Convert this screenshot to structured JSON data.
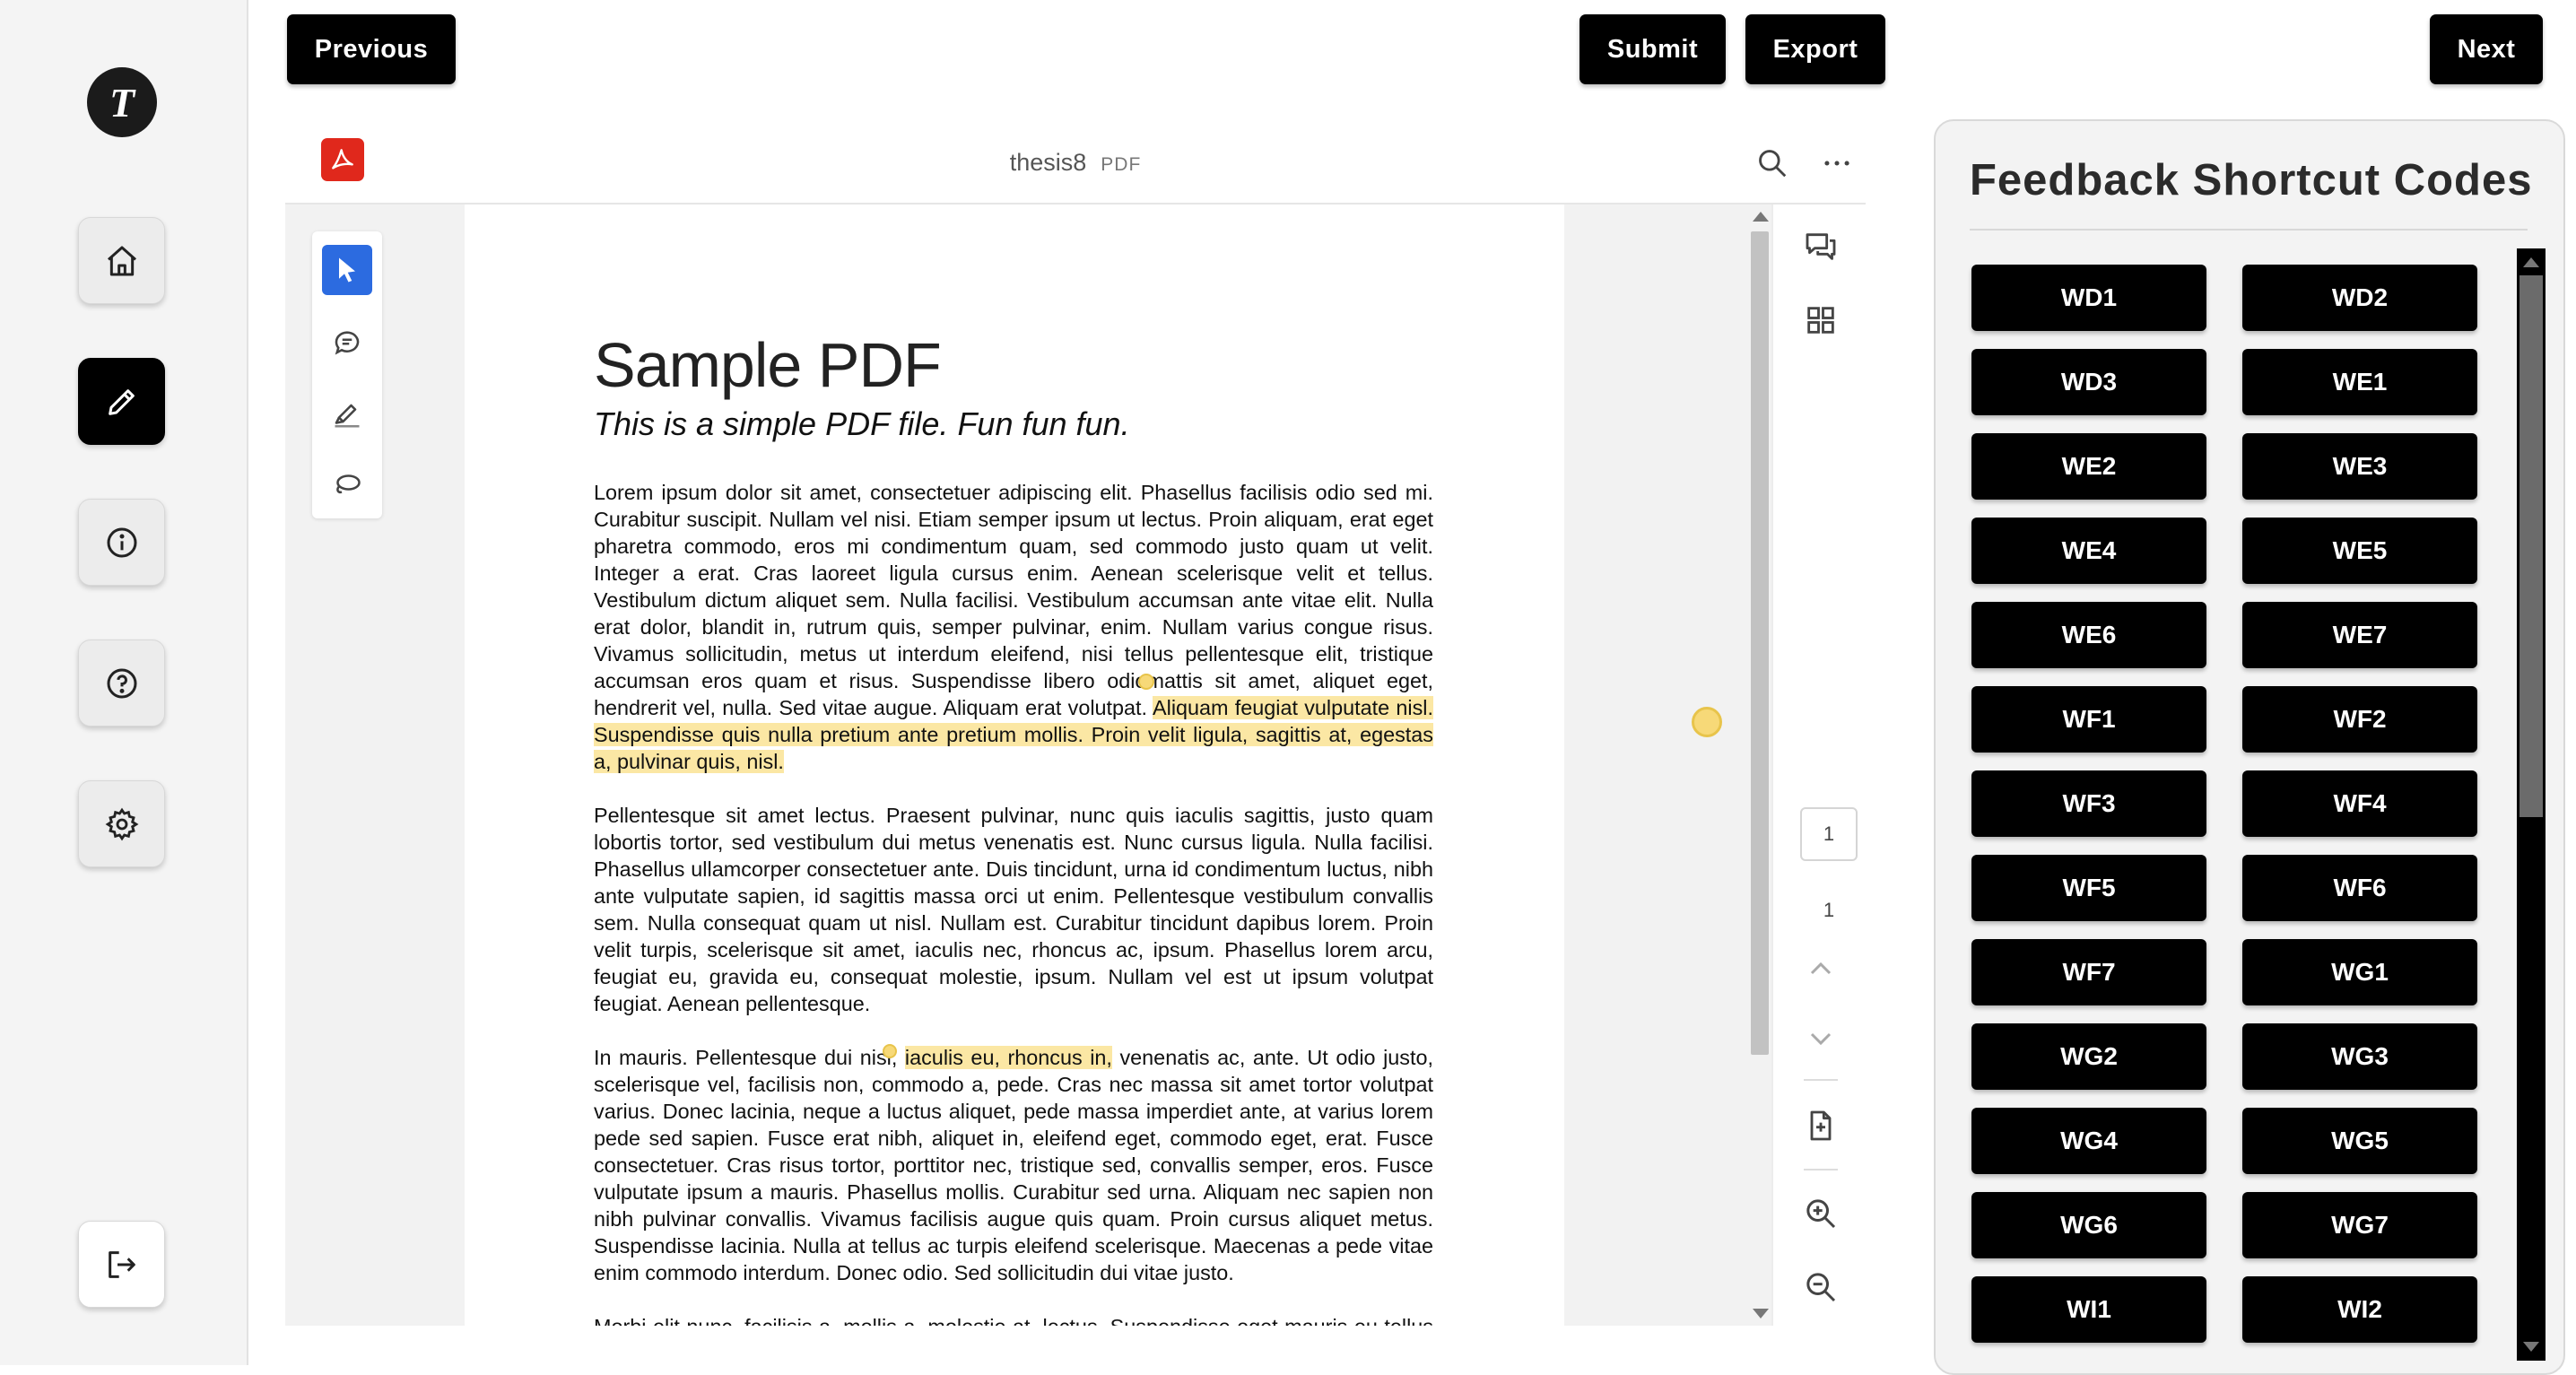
{
  "sidebar": {
    "logo_letter": "T",
    "items": [
      {
        "name": "home",
        "icon": "home-icon"
      },
      {
        "name": "edit",
        "icon": "pencil-icon",
        "active": true
      },
      {
        "name": "info",
        "icon": "info-icon"
      },
      {
        "name": "help",
        "icon": "help-icon"
      },
      {
        "name": "settings",
        "icon": "gear-icon"
      },
      {
        "name": "logout",
        "icon": "logout-icon"
      }
    ]
  },
  "toolbar": {
    "previous_label": "Previous",
    "submit_label": "Submit",
    "export_label": "Export",
    "next_label": "Next"
  },
  "viewer": {
    "file_name": "thesis8",
    "file_type": "PDF",
    "current_page": "1",
    "total_pages": "1",
    "tools": [
      "select-tool",
      "comment-tool",
      "highlight-tool",
      "lasso-tool"
    ]
  },
  "document": {
    "title": "Sample PDF",
    "subtitle": "This is a simple PDF file. Fun fun fun.",
    "para1": {
      "a": "Lorem ipsum dolor sit amet, consectetuer adipiscing elit. Phasellus facilisis odio sed mi. Curabitur suscipit. Nullam vel nisi. Etiam semper ipsum ut lectus. Proin aliquam, erat eget pharetra commodo, eros mi condimentum quam, sed commodo justo quam ut velit. Integer a erat. Cras laoreet ligula cursus enim. Aenean scelerisque velit et tellus. Vestibulum dictum aliquet sem. Nulla facilisi. Vestibulum accumsan ante vitae elit. Nulla erat dolor, blandit in, rutrum quis, semper pulvinar, enim. Nullam varius congue risus. Vivamus sollicitudin, metus ut interdum eleifend, nisi tellus pellentesque elit, tristique accumsan eros quam et risus. Suspendisse libero odio",
      "b": "mattis sit amet, aliquet eget, hendrerit vel, nulla. Sed vitae augue. Aliquam erat volutpat. ",
      "highlight": "Aliquam feugiat vulputate nisl. Suspendisse quis nulla pretium ante pretium mollis. Proin velit ligula, sagittis at, egestas a, pulvinar quis, nisl."
    },
    "para2": "Pellentesque sit amet lectus. Praesent pulvinar, nunc quis iaculis sagittis, justo quam lobortis tortor, sed vestibulum dui metus venenatis est. Nunc cursus ligula. Nulla facilisi. Phasellus ullamcorper consectetuer ante. Duis tincidunt, urna id condimentum luctus, nibh ante vulputate sapien, id sagittis massa orci ut enim. Pellentesque vestibulum convallis sem. Nulla consequat quam ut nisl. Nullam est. Curabitur tincidunt dapibus lorem. Proin velit turpis, scelerisque sit amet, iaculis nec, rhoncus ac, ipsum. Phasellus lorem arcu, feugiat eu, gravida eu, consequat molestie, ipsum. Nullam vel est ut ipsum volutpat feugiat. Aenean pellentesque.",
    "para3": {
      "a": "In mauris. Pellentesque dui nisi,",
      "highlight": "iaculis eu, rhoncus in,",
      "b": " venenatis ac, ante. Ut odio justo, scelerisque vel, facilisis non, commodo a, pede. Cras nec massa sit amet tortor volutpat varius. Donec lacinia, neque a luctus aliquet, pede massa imperdiet ante, at varius lorem pede sed sapien. Fusce erat nibh, aliquet in, eleifend eget, commodo eget, erat. Fusce consectetuer. Cras risus tortor, porttitor nec, tristique sed, convallis semper, eros. Fusce vulputate ipsum a mauris. Phasellus mollis. Curabitur sed urna. Aliquam nec sapien non nibh pulvinar convallis. Vivamus facilisis augue quis quam. Proin cursus aliquet metus. Suspendisse lacinia. Nulla at tellus ac turpis eleifend scelerisque. Maecenas a pede vitae enim commodo interdum. Donec odio. Sed sollicitudin dui vitae justo."
    },
    "para4": "Morbi elit nunc, facilisis a, mollis a, molestie at, lectus. Suspendisse eget mauris eu tellus molestie cursus. Duis ut magna at justo dignissim condimentum."
  },
  "feedback_panel": {
    "title": "Feedback Shortcut Codes",
    "codes": [
      "WD1",
      "WD2",
      "WD3",
      "WE1",
      "WE2",
      "WE3",
      "WE4",
      "WE5",
      "WE6",
      "WE7",
      "WF1",
      "WF2",
      "WF3",
      "WF4",
      "WF5",
      "WF6",
      "WF7",
      "WG1",
      "WG2",
      "WG3",
      "WG4",
      "WG5",
      "WG6",
      "WG7",
      "WI1",
      "WI2"
    ]
  },
  "colors": {
    "accent_blue": "#2c6be0",
    "pdf_red": "#e0281c",
    "highlight_yellow": "#fbe7a4",
    "button_black": "#000000"
  }
}
